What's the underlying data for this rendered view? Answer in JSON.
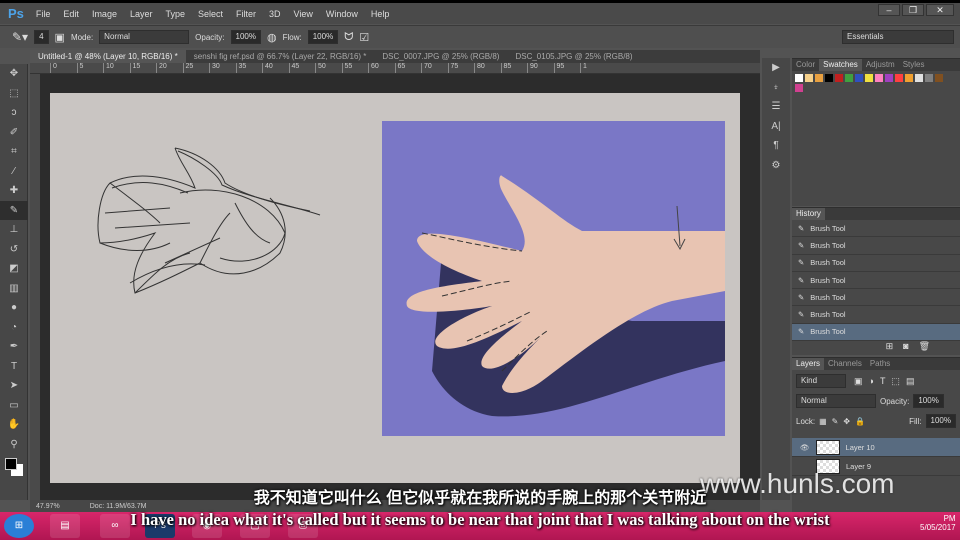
{
  "app": {
    "logo": "Ps",
    "menu": [
      "File",
      "Edit",
      "Image",
      "Layer",
      "Type",
      "Select",
      "Filter",
      "3D",
      "View",
      "Window",
      "Help"
    ],
    "window_controls": [
      "–",
      "❐",
      "✕"
    ]
  },
  "options": {
    "brush_size": "4",
    "mode_label": "Mode:",
    "mode_value": "Normal",
    "opacity_label": "Opacity:",
    "opacity_value": "100%",
    "flow_label": "Flow:",
    "flow_value": "100%",
    "workspace": "Essentials"
  },
  "tabs": [
    {
      "label": "Untitled-1 @ 48% (Layer 10, RGB/16) *",
      "active": true
    },
    {
      "label": "senshi fig ref.psd @ 66.7% (Layer 22, RGB/16) *"
    },
    {
      "label": "DSC_0007.JPG @ 25% (RGB/8)"
    },
    {
      "label": "DSC_0105.JPG @ 25% (RGB/8)"
    }
  ],
  "ruler": [
    "0",
    "5",
    "10",
    "15",
    "20",
    "25",
    "30",
    "35",
    "40",
    "45",
    "50",
    "55",
    "60",
    "65",
    "70",
    "75",
    "80",
    "85",
    "90",
    "95",
    "1"
  ],
  "swatches_panel": {
    "tabs": [
      "Color",
      "Swatches",
      "Adjustm",
      "Styles"
    ],
    "colors": [
      "#ffffff",
      "#f5d08a",
      "#e8a040",
      "#000000",
      "#c02020",
      "#40a040",
      "#3050c0",
      "#f0e040",
      "#ff80c0",
      "#a040c0",
      "#ff4040",
      "#f0a030",
      "#e0e0e0",
      "#808080",
      "#805020",
      "#d04090"
    ]
  },
  "history": {
    "title": "History",
    "items": [
      "Brush Tool",
      "Brush Tool",
      "Brush Tool",
      "Brush Tool",
      "Brush Tool",
      "Brush Tool",
      "Brush Tool"
    ]
  },
  "layers": {
    "tabs": [
      "Layers",
      "Channels",
      "Paths"
    ],
    "filter": "Kind",
    "blend": "Normal",
    "opacity_label": "Opacity:",
    "opacity": "100%",
    "lock_label": "Lock:",
    "fill_label": "Fill:",
    "fill": "100%",
    "items": [
      "Layer 10",
      "Layer 9"
    ]
  },
  "status": {
    "zoom": "47.97%",
    "doc": "Doc: 11.9M/63.7M"
  },
  "subtitles": {
    "chinese": "我不知道它叫什么 但它似乎就在我所说的手腕上的那个关节附近",
    "english": "I have no idea what it's called but it seems to be near that joint that I was talking about on the wrist"
  },
  "watermark": "www.hunls.com",
  "taskbar": {
    "time": "PM",
    "date": "5/05/2017"
  }
}
